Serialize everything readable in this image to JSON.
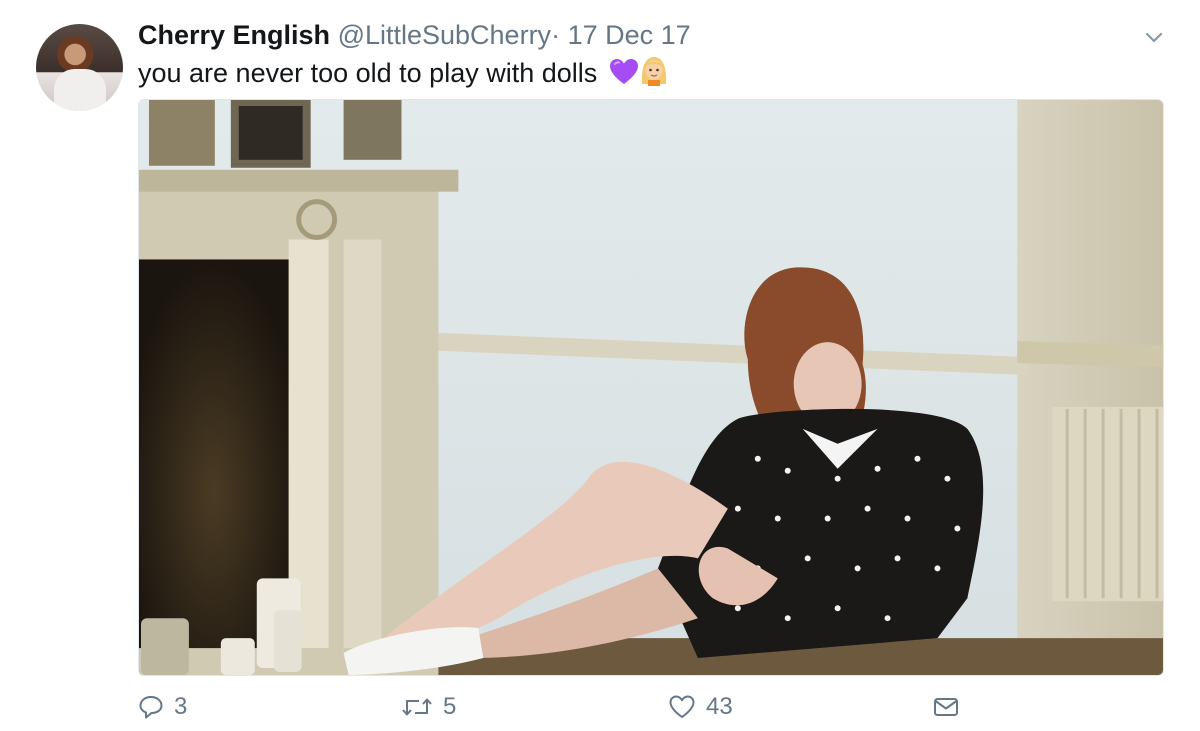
{
  "tweet": {
    "author_name": "Cherry English",
    "handle": "@LittleSubCherry",
    "separator": "·",
    "date": "17 Dec 17",
    "text": "you are never too old to play with dolls",
    "emojis": [
      "purple-heart",
      "blonde-girl-emoji"
    ]
  },
  "actions": {
    "replies": "3",
    "retweets": "5",
    "likes": "43"
  },
  "colors": {
    "name": "#14171a",
    "secondary": "#657786",
    "purple_heart": "#a64cf5"
  },
  "icons": [
    "reply-icon",
    "retweet-icon",
    "like-icon",
    "direct-message-icon",
    "chevron-down-icon"
  ]
}
